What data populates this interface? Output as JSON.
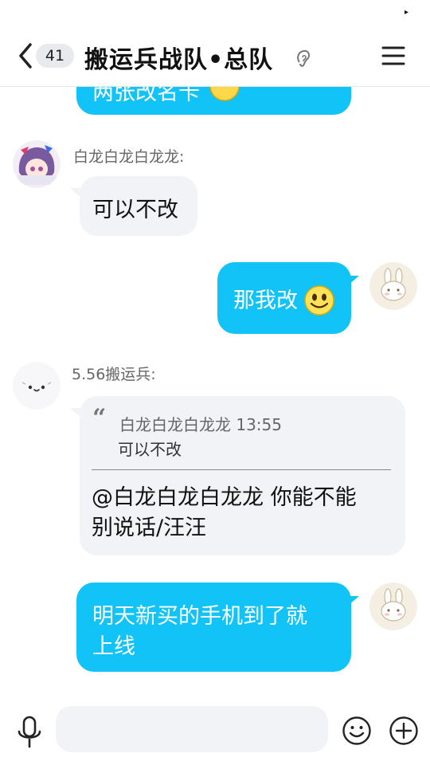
{
  "status": {
    "mark": "▸"
  },
  "header": {
    "back_icon": "chevron-left-icon",
    "unread_count": "41",
    "title": "搬运兵战队•总队",
    "ear_icon": "ear-icon",
    "menu_icon": "hamburger-menu-icon"
  },
  "messages": {
    "m0": {
      "text": "两张改名卡"
    },
    "m1": {
      "sender": "白龙白龙白龙龙:",
      "text": "可以不改"
    },
    "m2": {
      "text": "那我改"
    },
    "m3": {
      "sender": "5.56搬运兵:",
      "quote_mark": "“",
      "quote_header": "白龙白龙白龙龙 13:55",
      "quote_text": "可以不改",
      "reply_line1": "@白龙白龙白龙龙 你能不能",
      "reply_line2": "别说话/汪汪"
    },
    "m4": {
      "line1": "明天新买的手机到了就",
      "line2": "上线"
    }
  },
  "input_bar": {
    "placeholder": "",
    "mic_icon": "microphone-icon",
    "emoji_icon": "emoji-icon",
    "plus_icon": "plus-icon"
  },
  "colors": {
    "outgoing_bubble": "#12c3f7",
    "incoming_bubble": "#f2f3f7",
    "background": "#ffffff"
  }
}
